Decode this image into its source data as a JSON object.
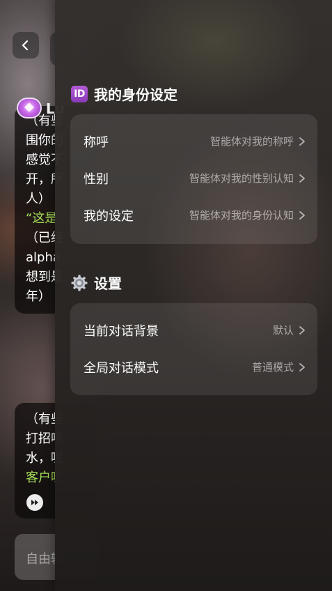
{
  "background": {
    "character_name": "Lu",
    "bubble1_lines": [
      "（有些",
      "围你的",
      "感觉不",
      "开，所",
      "人）",
      "“这是",
      "（已经",
      "alpha",
      "想到是",
      "年）"
    ],
    "bubble1_green_index": 5,
    "bubble2_lines": [
      "（有些",
      "打招呼",
      "水，呢",
      "客户呢"
    ],
    "bubble2_green_index": 3,
    "input_placeholder": "自由输"
  },
  "identity_section": {
    "icon_text": "ID",
    "title": "我的身份设定",
    "rows": [
      {
        "label": "称呼",
        "value": "智能体对我的称呼"
      },
      {
        "label": "性别",
        "value": "智能体对我的性别认知"
      },
      {
        "label": "我的设定",
        "value": "智能体对我的身份认知"
      }
    ]
  },
  "settings_section": {
    "icon": "gear-icon",
    "title": "设置",
    "rows": [
      {
        "label": "当前对话背景",
        "value": "默认"
      },
      {
        "label": "全局对话模式",
        "value": "普通模式"
      }
    ]
  },
  "colors": {
    "accent_green": "#a8e05a",
    "id_badge": "#9b47c6"
  }
}
